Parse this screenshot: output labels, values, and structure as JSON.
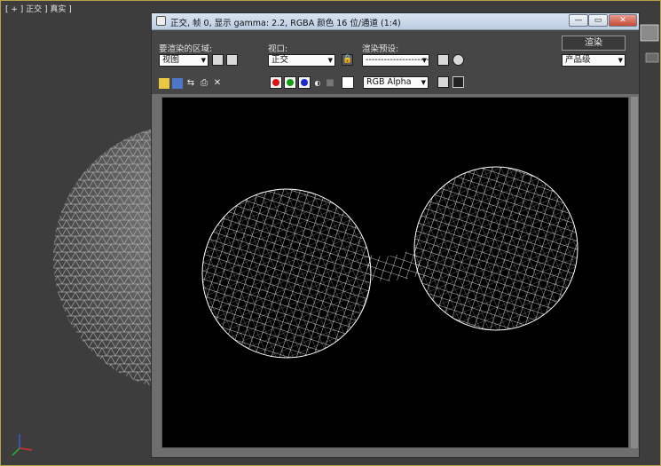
{
  "viewport": {
    "label": "[ + ] 正交 ] 真实 ]"
  },
  "window": {
    "title": "正交, 帧 0, 显示 gamma: 2.2, RGBA 颜色 16 位/通道 (1:4)",
    "controls": {
      "minimize": "—",
      "maximize": "▭",
      "close": "✕"
    }
  },
  "panel": {
    "area_label": "要渲染的区域:",
    "area_value": "视图",
    "viewport_label": "视口:",
    "viewport_value": "正交",
    "preset_label": "渲染预设:",
    "preset_value": "----------------------------",
    "render_button": "渲染",
    "quality_value": "产品级"
  },
  "toolbar": {
    "channel_display": "RGB Alpha",
    "channel_colors": {
      "red": "#e01010",
      "green": "#12a012",
      "blue": "#1a2ad0"
    }
  },
  "colors": {
    "viewport_bg": "#3d3d3d",
    "viewport_border": "#b7a04a",
    "render_bg": "#000000",
    "wire": "#ffffff"
  }
}
